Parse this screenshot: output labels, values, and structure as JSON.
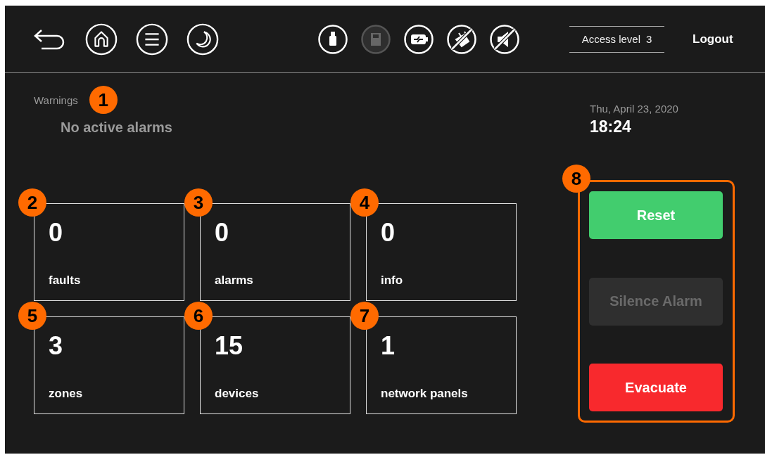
{
  "nav_icons": [
    {
      "kind": "back"
    },
    {
      "kind": "home"
    },
    {
      "kind": "menu"
    },
    {
      "kind": "night"
    }
  ],
  "status_icons": [
    {
      "kind": "usb",
      "active": true
    },
    {
      "kind": "sd-card",
      "active": false
    },
    {
      "kind": "battery",
      "active": true
    },
    {
      "kind": "no-power",
      "active": true
    },
    {
      "kind": "mute",
      "active": true
    }
  ],
  "access_level": {
    "label": "Access level",
    "value": "3"
  },
  "logout": "Logout",
  "warnings": {
    "label": "Warnings",
    "badge": "1",
    "message": "No active alarms"
  },
  "date": "Thu, April 23, 2020",
  "time": "18:24",
  "tiles": [
    {
      "badge": "2",
      "count": "0",
      "label": "faults"
    },
    {
      "badge": "3",
      "count": "0",
      "label": "alarms"
    },
    {
      "badge": "4",
      "count": "0",
      "label": "info"
    },
    {
      "badge": "5",
      "count": "3",
      "label": "zones"
    },
    {
      "badge": "6",
      "count": "15",
      "label": "devices"
    },
    {
      "badge": "7",
      "count": "1",
      "label": "network panels"
    }
  ],
  "actions": {
    "badge": "8",
    "buttons": [
      {
        "label": "Reset",
        "kind": "success",
        "disabled": false
      },
      {
        "label": "Silence Alarm",
        "kind": "neutral",
        "disabled": true
      },
      {
        "label": "Evacuate",
        "kind": "danger",
        "disabled": false
      }
    ]
  }
}
